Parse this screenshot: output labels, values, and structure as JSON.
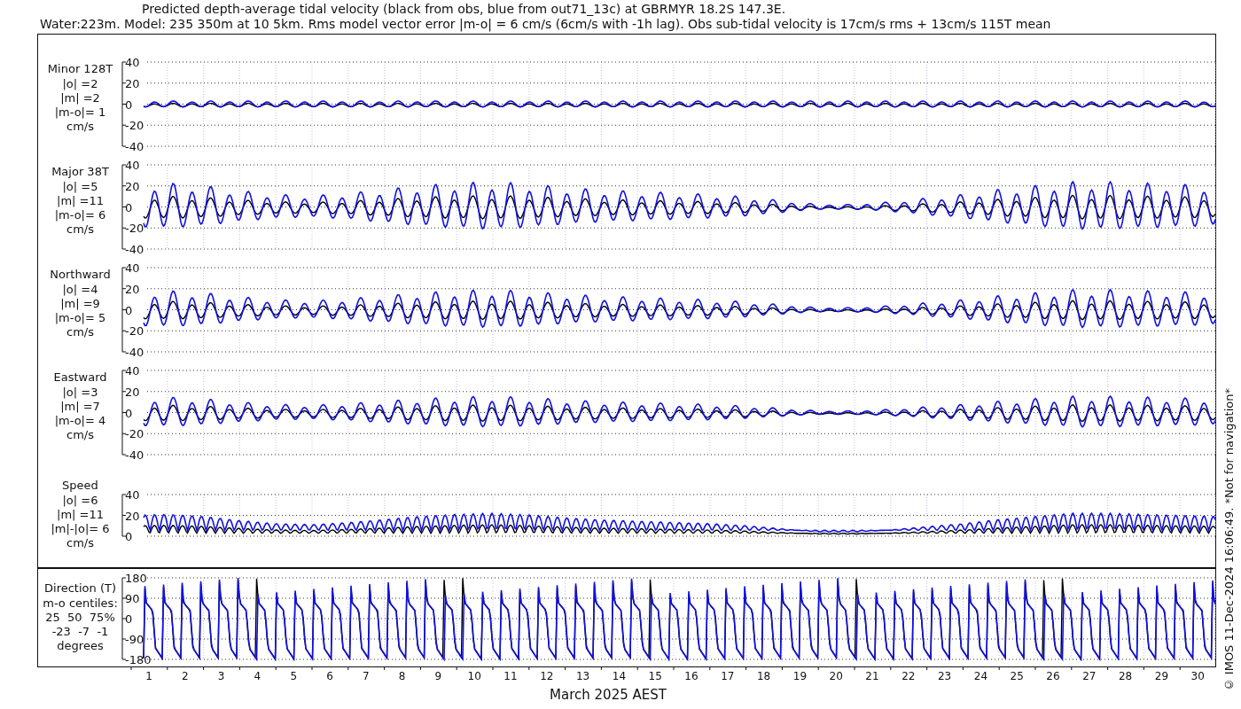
{
  "title": {
    "lines": [
      "Predicted depth-average tidal velocity (black from obs, blue from out71_13c) at GBRMYR 18.2S 147.3E.",
      "Water:223m. Model: 235 350m at 10 5km. Rms model vector error |m-o| = 6 cm/s (6cm/s with -1h lag). Obs sub-tidal velocity is 17cm/s rms + 13cm/s 115T mean"
    ]
  },
  "panels": [
    {
      "kind": "minor",
      "label_lines": [
        "Minor 128T",
        "|o| =2",
        "|m| =2",
        "|m-o|= 1",
        "cm/s"
      ],
      "y_tick_labels": [
        "40",
        "20",
        "0",
        "-20",
        "-40"
      ]
    },
    {
      "kind": "major",
      "label_lines": [
        "Major 38T",
        "|o| =5",
        "|m| =11",
        "|m-o|= 6",
        "cm/s"
      ],
      "y_tick_labels": [
        "40",
        "20",
        "0",
        "-20",
        "-40"
      ]
    },
    {
      "kind": "northward",
      "label_lines": [
        "Northward",
        "|o| =4",
        "|m| =9",
        "|m-o|= 5",
        "cm/s"
      ],
      "y_tick_labels": [
        "40",
        "20",
        "0",
        "-20",
        "-40"
      ]
    },
    {
      "kind": "eastward",
      "label_lines": [
        "Eastward",
        "|o| =3",
        "|m| =7",
        "|m-o|= 4",
        "cm/s"
      ],
      "y_tick_labels": [
        "40",
        "20",
        "0",
        "-20",
        "-40"
      ]
    },
    {
      "kind": "speed",
      "label_lines": [
        "Speed",
        "|o| =6",
        "|m| =11",
        "|m|-|o|= 6",
        "cm/s"
      ],
      "y_tick_labels": [
        "40",
        "20",
        "0"
      ]
    },
    {
      "kind": "direction",
      "label_lines": [
        "Direction (T)",
        "m-o centiles:",
        "25  50  75%",
        "-23  -7  -1",
        "degrees"
      ],
      "y_tick_labels": [
        "180",
        "90",
        "0",
        "-90",
        "-180"
      ]
    }
  ],
  "x_tick_labels": [
    "1",
    "2",
    "3",
    "4",
    "5",
    "6",
    "7",
    "8",
    "9",
    "10",
    "11",
    "12",
    "13",
    "14",
    "15",
    "16",
    "17",
    "18",
    "19",
    "20",
    "21",
    "22",
    "23",
    "24",
    "25",
    "26",
    "27",
    "28",
    "29",
    "30"
  ],
  "xlabel": "March 2025 AEST",
  "footer_note": "© IMOS 11-Dec-2024 16:06:49. *Not for navigation*"
}
